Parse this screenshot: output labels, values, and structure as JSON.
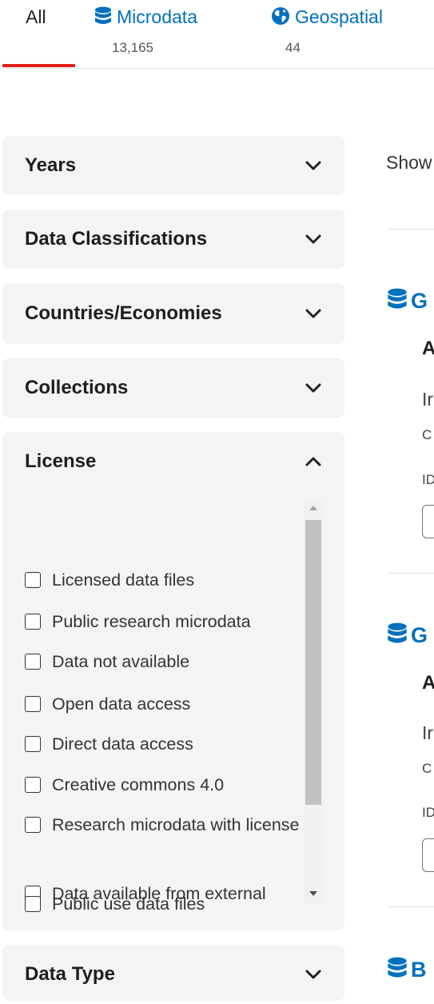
{
  "tabs": [
    {
      "label": "All",
      "count": "",
      "icon": "",
      "active": true
    },
    {
      "label": "Microdata",
      "count": "13,165",
      "icon": "database-icon",
      "active": false
    },
    {
      "label": "Geospatial",
      "count": "44",
      "icon": "globe-icon",
      "active": false
    }
  ],
  "filters": {
    "years": "Years",
    "classifications": "Data Classifications",
    "countries": "Countries/Economies",
    "collections": "Collections",
    "license": {
      "title": "License",
      "options": [
        "Licensed data files",
        "Public research microdata",
        "Data not available",
        "Open data access",
        "Direct data access",
        "Creative commons 4.0",
        "Research microdata with license",
        "Data available from external repository",
        "Public use data files"
      ]
    },
    "data_type": "Data Type"
  },
  "results": {
    "showing": "Show",
    "items": [
      {
        "title": "G",
        "subtitle": "A",
        "line1": "Ir",
        "line2": "C",
        "line3": "ID"
      },
      {
        "title": "G",
        "subtitle": "A",
        "line1": "Ir",
        "line2": "C",
        "line3": "ID"
      },
      {
        "title": "B"
      }
    ]
  },
  "colors": {
    "accent": "#0071bc",
    "active_tab": "#e32119",
    "panel_bg": "#f3f4f6"
  }
}
